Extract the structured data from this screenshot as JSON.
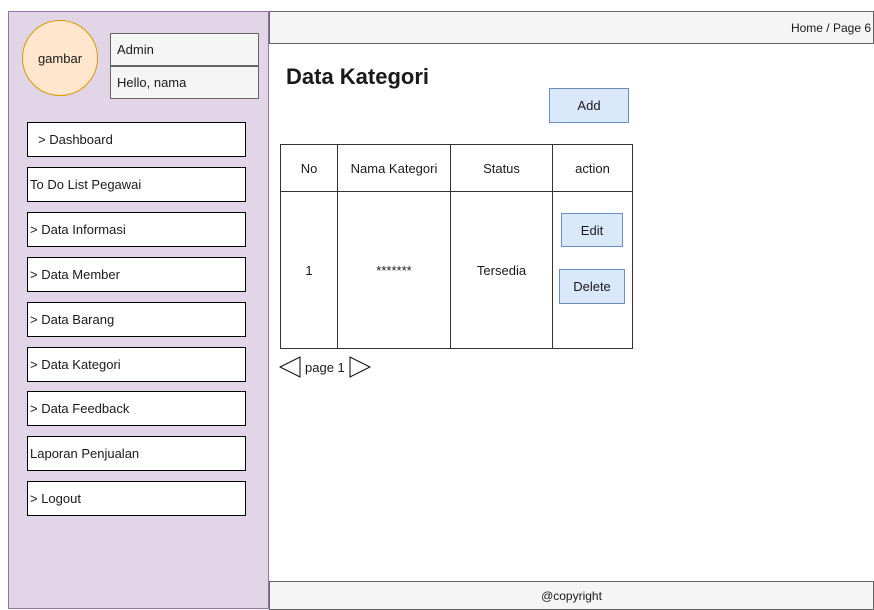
{
  "sidebar": {
    "avatar_label": "gambar",
    "role": "Admin",
    "greeting": "Hello, nama",
    "items": [
      {
        "label": "> Dashboard"
      },
      {
        "label": "To Do List Pegawai"
      },
      {
        "label": "> Data Informasi"
      },
      {
        "label": "> Data Member"
      },
      {
        "label": "> Data Barang"
      },
      {
        "label": "> Data Kategori"
      },
      {
        "label": "> Data Feedback"
      },
      {
        "label": "Laporan Penjualan"
      },
      {
        "label": "> Logout"
      }
    ]
  },
  "header": {
    "breadcrumb": "Home / Page 6"
  },
  "main": {
    "title": "Data Kategori",
    "add_label": "Add",
    "table": {
      "headers": [
        "No",
        "Nama Kategori",
        "Status",
        "action"
      ],
      "rows": [
        {
          "no": "1",
          "nama": "*******",
          "status": "Tersedia",
          "edit_label": "Edit",
          "delete_label": "Delete"
        }
      ]
    },
    "pagination": {
      "label": "page 1"
    }
  },
  "footer": {
    "text": "@copyright"
  },
  "colors": {
    "sidebar_bg": "#e1d5e7",
    "avatar_bg": "#ffe6cc",
    "button_bg": "#dae8fc",
    "bar_bg": "#f5f5f5"
  }
}
